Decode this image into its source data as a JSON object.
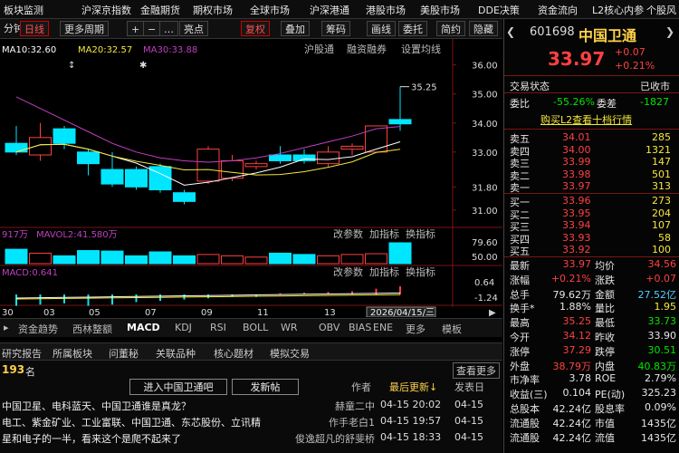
{
  "menu": [
    "板块监测",
    "沪深京指数",
    "金融期货",
    "期权市场",
    "全球市场",
    "沪深港通",
    "港股市场",
    "美股市场",
    "DDE决策",
    "资金流向",
    "L2核心内参",
    "个股风"
  ],
  "toolbar": {
    "period": "分钟",
    "day": "日线",
    "more": "更多周期",
    "plus": "+",
    "minus": "−",
    "dots": "…",
    "cursor": "亮点",
    "fq": "复权",
    "overlay": "叠加",
    "chips": "筹码",
    "draw": "画线",
    "delegate": "委托",
    "simple": "简约",
    "hide": "隐藏"
  },
  "ma": {
    "ma10": "MA10:32.60",
    "ma20": "MA20:32.57",
    "ma30": "MA30:33.88",
    "hs": "沪股通",
    "rz": "融资融券",
    "sz": "设置均线"
  },
  "vol": {
    "vol": "917万",
    "mavol": "MAVOL2:41.580万",
    "btn1": "改参数",
    "btn2": "加指标",
    "btn3": "换指标"
  },
  "macd": {
    "label": "MACD:0.641",
    "btn1": "改参数",
    "btn2": "加指标",
    "btn3": "换指标"
  },
  "price_axis": [
    "36.00",
    "35.00",
    "34.00",
    "33.00",
    "31.80",
    "31.00"
  ],
  "vol_axis": [
    "79.60",
    "50.00"
  ],
  "macd_axis": [
    "0.64",
    "-1.24"
  ],
  "high_mark": "35.25",
  "markers": [
    "↕",
    "✱"
  ],
  "date_axis": [
    "30",
    "03",
    "05",
    "07",
    "09",
    "11",
    "13"
  ],
  "date_box": "2026/04/15/三",
  "bottom_tabs": [
    "资金趋势",
    "西林整额",
    "MACD",
    "KDJ",
    "RSI",
    "BOLL",
    "WR",
    "OBV",
    "BIAS",
    "ENE",
    "更多",
    "模板"
  ],
  "news_tabs": [
    "研究报告",
    "所属板块",
    "问董秘",
    "关联品种",
    "核心题材",
    "模拟交易"
  ],
  "rank": "193",
  "rank_suffix": "名",
  "news_btns": {
    "enter": "进入中国卫通吧",
    "post": "发新帖",
    "author": "作者",
    "latest": "最后更新↓",
    "pub": "发表日",
    "more": "查看更多"
  },
  "news": [
    {
      "title": "中国卫星、电科蓝天、中国卫通谁是真龙？",
      "author": "赫童二中",
      "upd": "04-15 20:02",
      "pub": "04-15"
    },
    {
      "title": "电工、紫金矿业、工业富联、中国卫通、东芯股份、立讯精",
      "author": "作手老白1",
      "upd": "04-15 19:57",
      "pub": "04-15"
    },
    {
      "title": "星和电子的一半，看来这个是爬不起来了",
      "author": "俊逸超凡的舒斐桥",
      "upd": "04-15 18:33",
      "pub": "04-15"
    }
  ],
  "quote": {
    "code": "601698",
    "name": "中国卫通",
    "price": "33.97",
    "chg": "+0.07",
    "pct": "+0.21%",
    "status_l": "交易状态",
    "status_r": "已收市",
    "wb_l": "委比",
    "wb": "-55.26%",
    "wc_l": "委差",
    "wc": "-1827",
    "l2": "购买L2查看十档行情"
  },
  "asks": [
    {
      "l": "卖五",
      "p": "34.01",
      "v": "285"
    },
    {
      "l": "卖四",
      "p": "34.00",
      "v": "1321"
    },
    {
      "l": "卖三",
      "p": "33.99",
      "v": "147"
    },
    {
      "l": "卖二",
      "p": "33.98",
      "v": "501"
    },
    {
      "l": "卖一",
      "p": "33.97",
      "v": "313"
    }
  ],
  "bids": [
    {
      "l": "买一",
      "p": "33.96",
      "v": "273"
    },
    {
      "l": "买二",
      "p": "33.95",
      "v": "204"
    },
    {
      "l": "买三",
      "p": "33.94",
      "v": "107"
    },
    {
      "l": "买四",
      "p": "33.93",
      "v": "58"
    },
    {
      "l": "买五",
      "p": "33.92",
      "v": "100"
    }
  ],
  "stats": [
    {
      "l1": "最新",
      "v1": "33.97",
      "c1": "red",
      "l2": "均价",
      "v2": "34.56",
      "c2": "red"
    },
    {
      "l1": "涨幅",
      "v1": "+0.21%",
      "c1": "red",
      "l2": "涨跌",
      "v2": "+0.07",
      "c2": "red"
    },
    {
      "l1": "总手",
      "v1": "79.62万",
      "c1": "white",
      "l2": "金额",
      "v2": "27.52亿",
      "c2": "cyan"
    },
    {
      "l1": "换手*",
      "v1": "1.88%",
      "c1": "white",
      "l2": "量比",
      "v2": "1.95",
      "c2": "yellow"
    },
    {
      "l1": "最高",
      "v1": "35.25",
      "c1": "red",
      "l2": "最低",
      "v2": "33.73",
      "c2": "green"
    },
    {
      "l1": "今开",
      "v1": "34.12",
      "c1": "red",
      "l2": "昨收",
      "v2": "33.90",
      "c2": "white"
    },
    {
      "l1": "涨停",
      "v1": "37.29",
      "c1": "red",
      "l2": "跌停",
      "v2": "30.51",
      "c2": "green"
    },
    {
      "l1": "外盘",
      "v1": "38.79万",
      "c1": "red",
      "l2": "内盘",
      "v2": "40.83万",
      "c2": "green"
    },
    {
      "l1": "市净率",
      "v1": "3.78",
      "c1": "white",
      "l2": "ROE",
      "v2": "2.79%",
      "c2": "white"
    },
    {
      "l1": "收益(三)",
      "v1": "0.104",
      "c1": "white",
      "l2": "PE(动)",
      "v2": "325.23",
      "c2": "white"
    },
    {
      "l1": "总股本",
      "v1": "42.24亿",
      "c1": "white",
      "l2": "股息率",
      "v2": "0.09%",
      "c2": "white"
    },
    {
      "l1": "流通股",
      "v1": "42.24亿",
      "c1": "white",
      "l2": "市值",
      "v2": "1435亿",
      "c2": "white"
    },
    {
      "l1": "流通股",
      "v1": "42.24亿",
      "c1": "white",
      "l2": "流值",
      "v2": "1435亿",
      "c2": "white"
    }
  ],
  "colors": {
    "up": "#ff4040",
    "down": "#00e6ff",
    "ma10": "#ffffff",
    "ma20": "#f5e83a",
    "ma30": "#c040c0"
  },
  "candles": [
    {
      "o": 33.3,
      "c": 33.0,
      "h": 33.9,
      "l": 32.9
    },
    {
      "o": 32.9,
      "c": 33.5,
      "h": 34.0,
      "l": 32.7
    },
    {
      "o": 33.8,
      "c": 33.3,
      "h": 33.9,
      "l": 33.1
    },
    {
      "o": 33.0,
      "c": 32.6,
      "h": 33.1,
      "l": 32.2
    },
    {
      "o": 32.4,
      "c": 31.9,
      "h": 33.0,
      "l": 31.8
    },
    {
      "o": 32.4,
      "c": 31.8,
      "h": 32.5,
      "l": 31.7
    },
    {
      "o": 32.5,
      "c": 31.7,
      "h": 32.6,
      "l": 31.6
    },
    {
      "o": 31.6,
      "c": 31.3,
      "h": 31.7,
      "l": 31.2
    },
    {
      "o": 32.0,
      "c": 33.1,
      "h": 33.2,
      "l": 31.9
    },
    {
      "o": 32.1,
      "c": 32.7,
      "h": 32.9,
      "l": 32.0
    },
    {
      "o": 32.5,
      "c": 32.6,
      "h": 32.7,
      "l": 32.4
    },
    {
      "o": 32.9,
      "c": 32.7,
      "h": 33.2,
      "l": 32.6
    },
    {
      "o": 32.9,
      "c": 32.7,
      "h": 33.1,
      "l": 32.6
    },
    {
      "o": 32.6,
      "c": 33.0,
      "h": 33.2,
      "l": 32.5
    },
    {
      "o": 33.1,
      "c": 33.2,
      "h": 33.3,
      "l": 32.9
    },
    {
      "o": 33.0,
      "c": 33.9,
      "h": 33.9,
      "l": 33.0
    },
    {
      "o": 34.12,
      "c": 33.97,
      "h": 35.25,
      "l": 33.73
    }
  ],
  "volumes": [
    55,
    40,
    30,
    50,
    48,
    30,
    45,
    30,
    35,
    30,
    25,
    40,
    35,
    30,
    35,
    38,
    79.6
  ],
  "macd_vals": [
    -0.9,
    -0.8,
    -0.7,
    -0.9,
    -0.8,
    -0.6,
    -0.5,
    -0.4,
    -0.3,
    -0.2,
    -0.2,
    0.1,
    0.15,
    0.2,
    0.25,
    0.45,
    0.641
  ]
}
